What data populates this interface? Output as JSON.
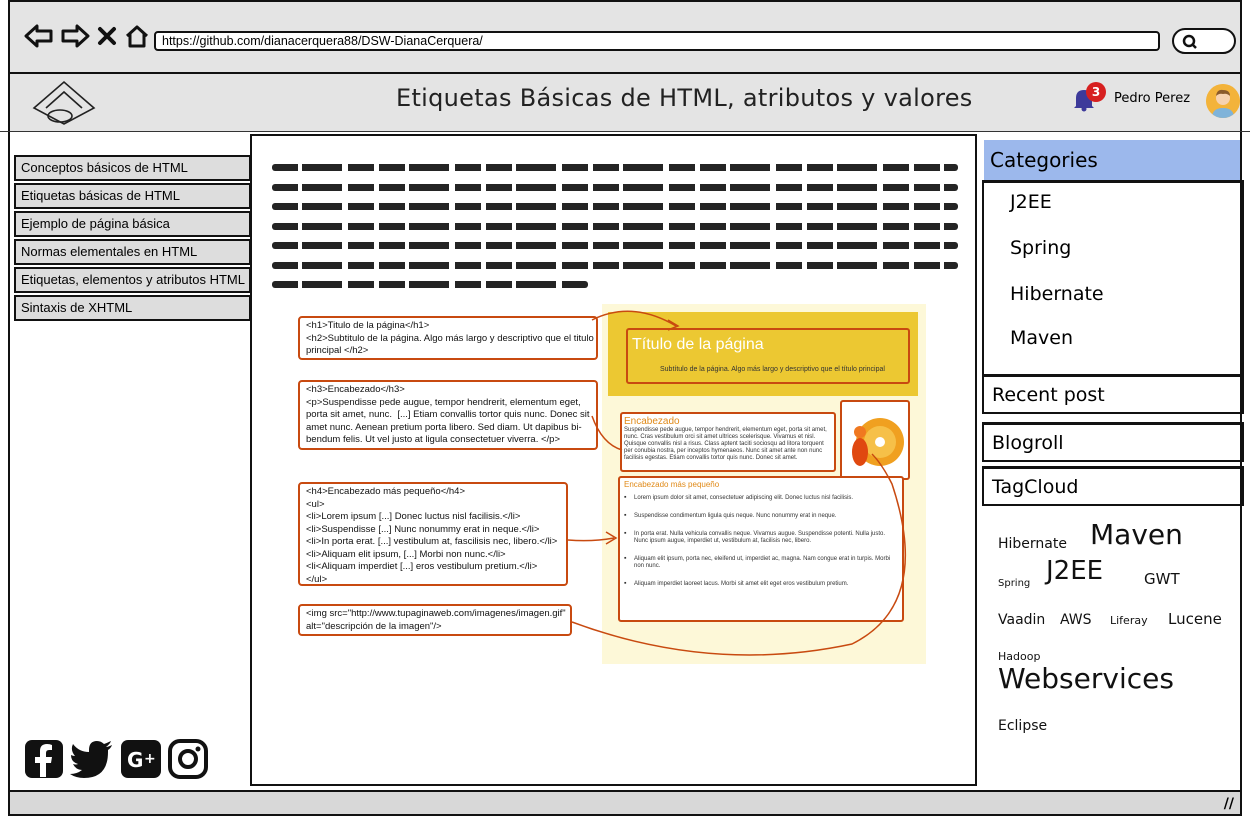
{
  "browser": {
    "url": "https://github.com/dianacerquera88/DSW-DianaCerquera/"
  },
  "header": {
    "title": "Etiquetas Básicas de HTML, atributos y valores",
    "notifications_count": "3",
    "user_name": "Pedro Perez"
  },
  "sidebar": {
    "items": [
      {
        "label": "Conceptos básicos de HTML"
      },
      {
        "label": "Etiquetas básicas de HTML"
      },
      {
        "label": "Ejemplo de página básica"
      },
      {
        "label": "Normas elementales en HTML"
      },
      {
        "label": "Etiquetas, elementos y atributos HTML"
      },
      {
        "label": "Sintaxis de XHTML"
      }
    ]
  },
  "diagram": {
    "code_h1": "<h1>Titulo de la página</h1>\n<h2>Subtitulo de la página. Algo más largo y descriptivo que el titulo\nprincipal </h2>",
    "code_h3": "<h3>Encabezado</h3>\n<p>Suspendisse pede augue, tempor hendrerit, elementum eget,\nporta sit amet, nunc.  [...] Etiam convallis tortor quis nunc. Donec sit\namet nunc. Aenean pretium porta libero. Sed diam. Ut dapibus bi-\nbendum felis. Ut vel justo at ligula consectetuer viverra. </p>",
    "code_h4": "<h4>Encabezado más pequeño</h4>\n<ul>\n<li>Lorem ipsum [...] Donec luctus nisl facilisis.</li>\n<li>Suspendisse [...] Nunc nonummy erat in neque.</li>\n<li>In porta erat. [...] vestibulum at, fascilisis nec, libero.</li>\n<li>Aliquam elit ipsum, [...] Morbi non nunc.</li>\n<li<Aliquam imperdiet [...] eros vestibulum pretium.</li>\n</ul>",
    "code_img": "<img src=\"http://www.tupaginaweb.com/imagenes/imagen.gif\"\nalt=\"descripción de la imagen\"/>",
    "preview_title": "Título de la página",
    "preview_subtitle": "Subtítulo de la página. Algo más largo y descriptivo que el título principal",
    "preview_section_heading": "Encabezado",
    "preview_section_text": "Suspendisse pede augue, tempor hendrerit, elementum eget, porta sit amet, nunc. Cras vestibulum orci sit amet ultrices scelerisque. Vivamus et nisl. Quisque convallis nisl a risus. Class aptent taciti sociosqu ad litora torquent per conubia nostra, per inceptos hymenaeos. Nunc sit amet ante non nunc facilisis egestas. Etiam convallis tortor quis nunc. Donec sit amet.",
    "preview_list_heading": "Encabezado más pequeño",
    "preview_list": [
      "Lorem ipsum dolor sit amet, consectetuer adipiscing elit. Donec luctus nisl facilisis.",
      "Suspendisse condimentum ligula quis neque. Nunc nonummy erat in neque.",
      "In porta erat. Nulla vehicula convallis neque. Vivamus augue. Suspendisse potenti. Nulla justo. Nunc ipsum augue, imperdiet ut, vestibulum at, facilisis nec, libero.",
      "Aliquam elit ipsum, porta nec, eleifend ut, imperdiet ac, magna. Nam congue erat in turpis. Morbi non nunc.",
      "Aliquam imperdiet laoreet lacus. Morbi sit amet elit eget eros vestibulum pretium."
    ]
  },
  "categories": {
    "heading": "Categories",
    "items": [
      "J2EE",
      "Spring",
      "Hibernate",
      "Maven"
    ]
  },
  "sections": {
    "recent_post": "Recent post",
    "blogroll": "Blogroll",
    "tagcloud": "TagCloud"
  },
  "tags": [
    "Hibernate",
    "Maven",
    "Spring",
    "J2EE",
    "GWT",
    "Vaadin",
    "AWS",
    "Liferay",
    "Lucene",
    "Hadoop",
    "Webservices",
    "Eclipse"
  ],
  "social": [
    "facebook-icon",
    "twitter-icon",
    "google-plus-icon",
    "instagram-icon"
  ]
}
